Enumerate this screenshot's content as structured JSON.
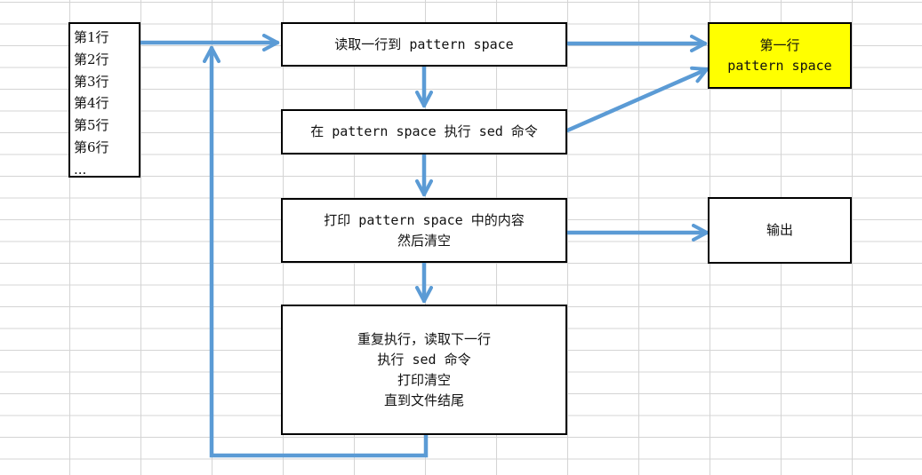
{
  "input_lines": [
    "第1行",
    "第2行",
    "第3行",
    "第4行",
    "第5行",
    "第6行",
    "..."
  ],
  "steps": {
    "read": [
      "读取一行到 pattern space"
    ],
    "execute": [
      "在 pattern space 执行 sed 命令"
    ],
    "print": [
      "打印 pattern space 中的内容",
      "然后清空"
    ],
    "repeat": [
      "重复执行，读取下一行",
      "执行 sed 命令",
      "打印清空",
      "直到文件结尾"
    ]
  },
  "pattern_space_box": [
    "第一行",
    "pattern space"
  ],
  "output_box": [
    "输出"
  ],
  "colors": {
    "arrow": "#5b9bd5",
    "highlight": "#ffff00",
    "border": "#000000",
    "grid": "#d4d4d4"
  }
}
